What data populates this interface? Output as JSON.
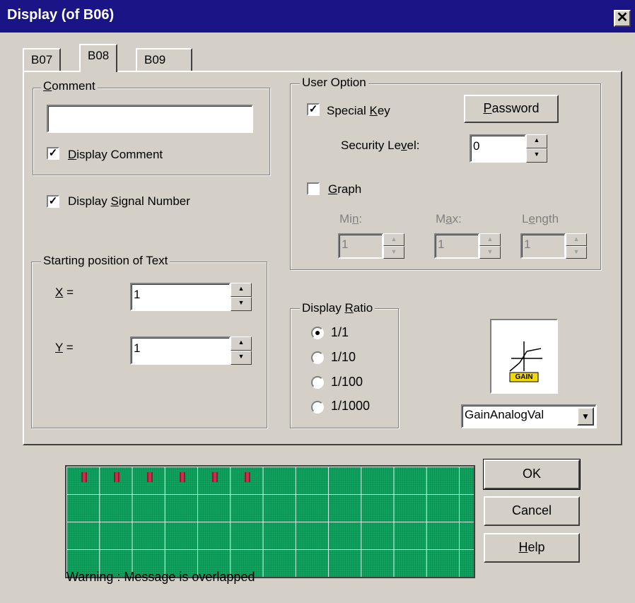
{
  "window": {
    "title": "Display (of B06)"
  },
  "tabs": [
    {
      "label": "B07"
    },
    {
      "label": "B08"
    },
    {
      "label": "B09"
    }
  ],
  "comment": {
    "legend_pre": "",
    "legend_ul": "C",
    "legend_post": "omment",
    "value": "",
    "display_comment_ul": "D",
    "display_comment_post": "isplay Comment",
    "display_comment_checked": true
  },
  "signal": {
    "label_pre": "Display ",
    "label_ul": "S",
    "label_post": "ignal Number",
    "checked": true
  },
  "starting_position": {
    "legend": "Starting position of Text",
    "x_label_ul": "X",
    "x_label_post": " =",
    "x_value": "1",
    "y_label_ul": "Y",
    "y_label_post": " =",
    "y_value": "1"
  },
  "user_option": {
    "legend": "User Option",
    "special_key_pre": "Special ",
    "special_key_ul": "K",
    "special_key_post": "ey",
    "special_key_checked": true,
    "password_ul": "P",
    "password_post": "assword",
    "security_level_pre": "Security Le",
    "security_level_ul": "v",
    "security_level_post": "el:",
    "security_level_value": "0",
    "graph_ul": "G",
    "graph_post": "raph",
    "graph_checked": false,
    "min_pre": "Mi",
    "min_ul": "n",
    "min_post": ":",
    "min_value": "1",
    "max_pre": "M",
    "max_ul": "a",
    "max_post": "x:",
    "max_value": "1",
    "length_pre": "L",
    "length_ul": "e",
    "length_post": "ngth",
    "length_value": "1"
  },
  "display_ratio": {
    "legend_pre": "Display ",
    "legend_ul": "R",
    "legend_post": "atio",
    "options": [
      {
        "label": "1/1",
        "selected": true
      },
      {
        "label": "1/10",
        "selected": false
      },
      {
        "label": "1/100",
        "selected": false
      },
      {
        "label": "1/1000",
        "selected": false
      }
    ]
  },
  "gain": {
    "icon_text": "GAIN",
    "combo_value": "GainAnalogVal"
  },
  "buttons": {
    "ok": "OK",
    "cancel": "Cancel",
    "help_ul": "H",
    "help_post": "elp"
  },
  "preview": {
    "marker_count": 6,
    "columns": 12,
    "rows": 4,
    "warning": "Warning : Message is overlapped"
  },
  "colors": {
    "title_bar": "#1a1486",
    "grid_green": "#0fa561",
    "marker_red": "#c7304a"
  }
}
